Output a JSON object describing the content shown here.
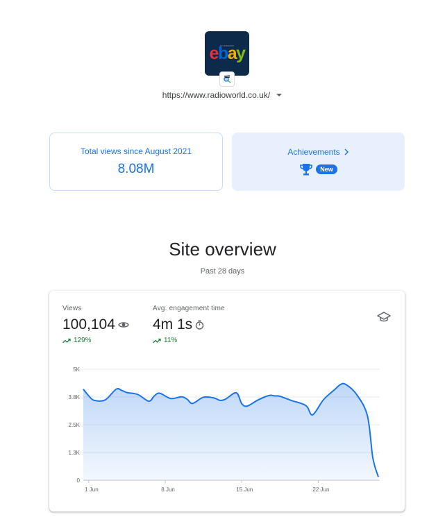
{
  "site": {
    "logo_text": {
      "e": "e",
      "b": "b",
      "a": "a",
      "y": "y"
    },
    "url": "https://www.radioworld.co.uk/"
  },
  "cards": {
    "views_label": "Total views since August 2021",
    "views_value": "8.08M",
    "achievements_label": "Achievements",
    "new_badge": "New"
  },
  "overview": {
    "title": "Site overview",
    "subtitle": "Past 28 days"
  },
  "metrics": {
    "views": {
      "label": "Views",
      "value": "100,104",
      "change": "129%"
    },
    "engagement": {
      "label": "Avg. engagement time",
      "value": "4m 1s",
      "change": "11%"
    }
  },
  "colors": {
    "accent": "#1a73e8",
    "positive": "#188038",
    "line": "#1a73e8"
  },
  "icons": [
    "eye-icon",
    "timer-icon",
    "trending-up-icon",
    "school-icon",
    "trophy-icon",
    "chevron-right-icon",
    "dropdown-arrow-icon"
  ],
  "chart_data": {
    "type": "area",
    "ylim": [
      0,
      5000
    ],
    "yticks": [
      "0",
      "1.3K",
      "2.5K",
      "3.8K",
      "5K"
    ],
    "ytick_values": [
      0,
      1250,
      2500,
      3750,
      5000
    ],
    "xticks": [
      "1 Jun",
      "8 Jun",
      "15 Jun",
      "22 Jun"
    ],
    "xtick_days": [
      1,
      8,
      15,
      22
    ],
    "grid": true,
    "series": [
      {
        "day": [
          0.5,
          1,
          1.5,
          2.5,
          3.5,
          4,
          4.5,
          5.5,
          6.5,
          7,
          7.5,
          8.5,
          9.5,
          10,
          10.5,
          11.5,
          12.5,
          13,
          13.5,
          14.5,
          15,
          15.5,
          16.5,
          17.5,
          18,
          18.5,
          19.5,
          20.5,
          21,
          21.5,
          22.5,
          23.5,
          24,
          24.5,
          25.5,
          26.5,
          27,
          27.5
        ],
        "values": [
          4100,
          3800,
          3600,
          3620,
          4100,
          4050,
          3950,
          3860,
          3560,
          3800,
          3920,
          3680,
          3760,
          3650,
          3460,
          3740,
          3700,
          3600,
          3650,
          3940,
          3450,
          3340,
          3620,
          3820,
          3800,
          3780,
          3600,
          3450,
          3300,
          2950,
          3640,
          4080,
          4300,
          4320,
          3870,
          2900,
          1000,
          150
        ]
      }
    ]
  }
}
